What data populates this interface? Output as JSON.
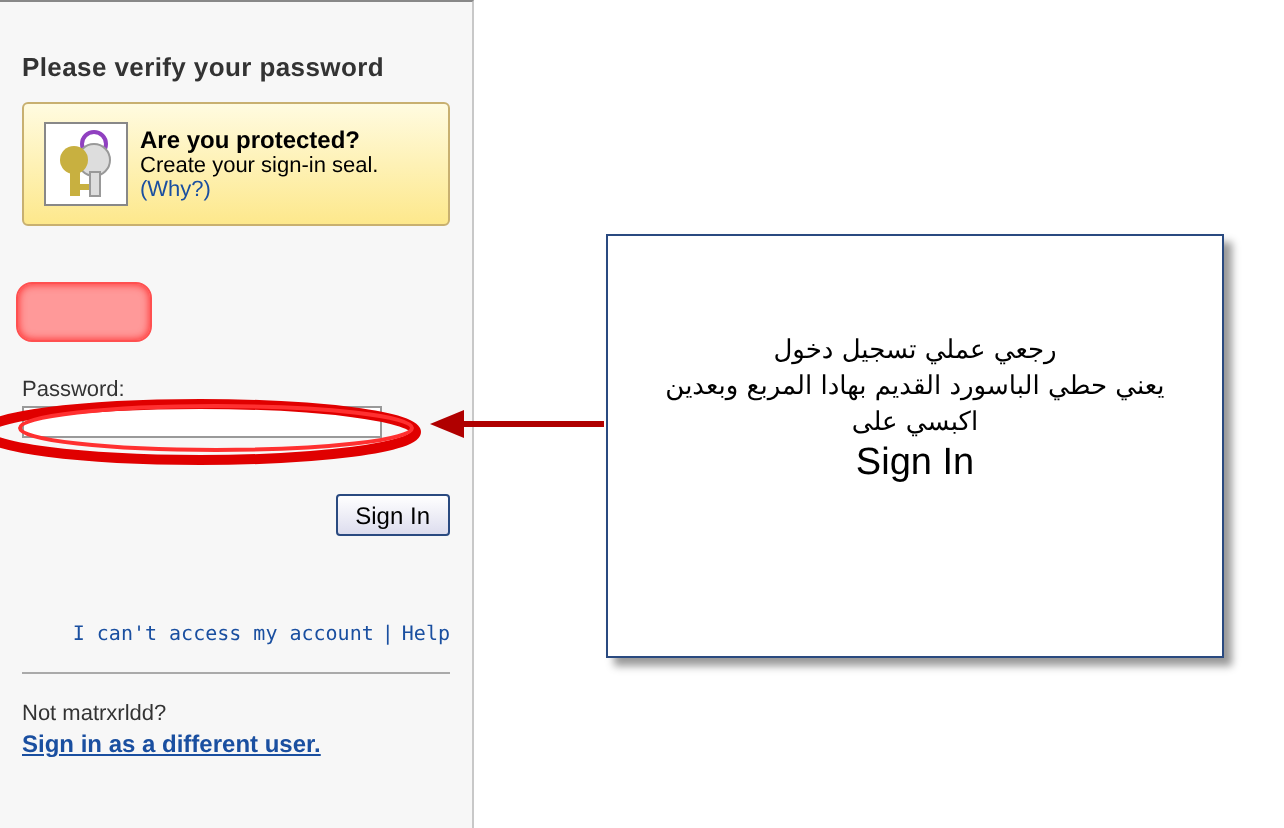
{
  "panel": {
    "title": "Please verify your password",
    "seal": {
      "heading": "Are you protected?",
      "text": "Create your sign-in seal.",
      "link": "(Why?)"
    },
    "password": {
      "label": "Password:"
    },
    "button": "Sign In",
    "links": [
      {
        "text": "I can't access my account"
      },
      {
        "text": "Help"
      }
    ],
    "separator": "|",
    "user_prompt": "Not matrxrldd?",
    "switch_link": "Sign in as a different user."
  },
  "callout": {
    "lines": [
      "رجعي عملي تسجيل دخول",
      "يعني حطي الباسورد القديم بهادا المربع وبعدين",
      "اكبسي على",
      "Sign In"
    ]
  }
}
